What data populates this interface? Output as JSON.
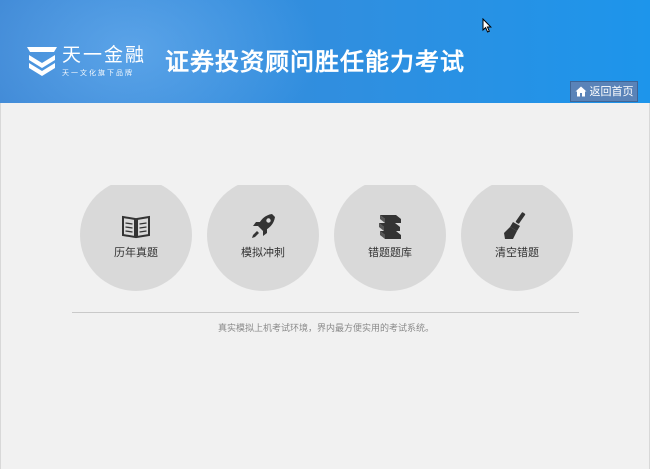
{
  "header": {
    "brand_name": "天一金融",
    "brand_subtitle": "天一文化旗下品牌",
    "app_title": "证券投资顾问胜任能力考试",
    "home_button_label": "返回首页",
    "colors": {
      "header_blue": "#2f8fe0",
      "home_button_bg": "#5a83b8"
    }
  },
  "menu": {
    "items": [
      {
        "label": "历年真题",
        "icon": "book-icon"
      },
      {
        "label": "模拟冲刺",
        "icon": "rocket-icon"
      },
      {
        "label": "错题题库",
        "icon": "stacked-books-icon"
      },
      {
        "label": "清空错题",
        "icon": "broom-icon"
      }
    ]
  },
  "footer": {
    "tagline": "真实模拟上机考试环境，界内最方便实用的考试系统。"
  }
}
